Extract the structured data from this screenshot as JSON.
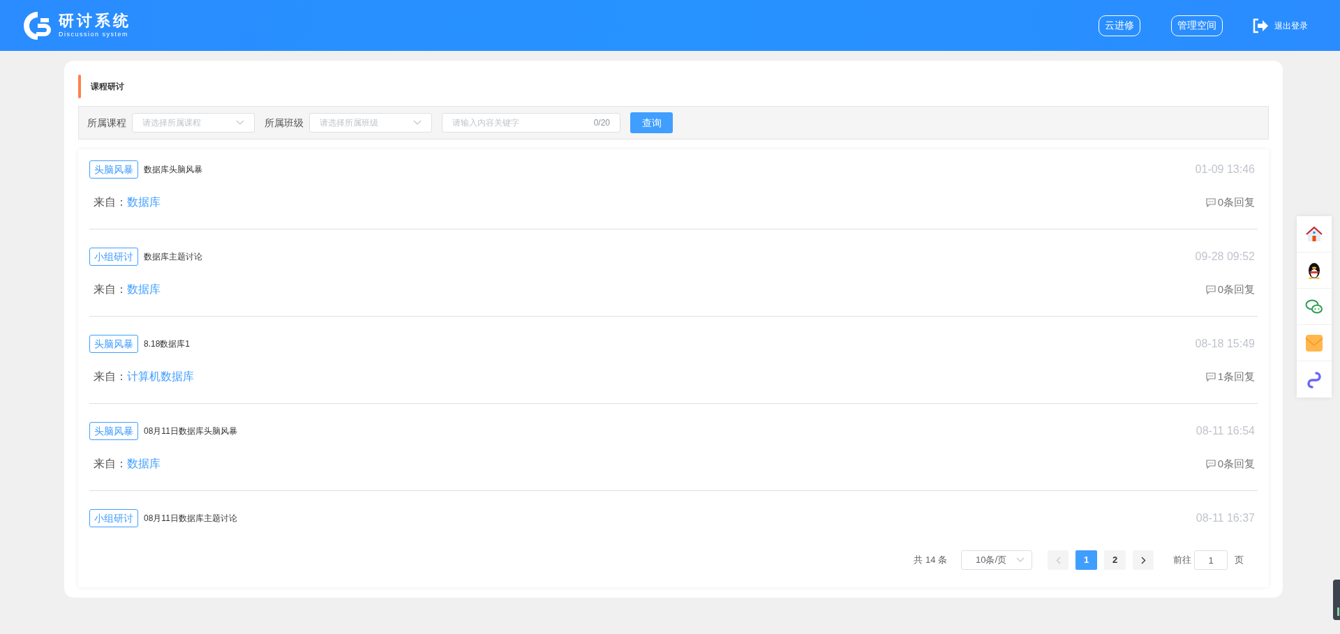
{
  "header": {
    "logo": {
      "title": "研讨系统",
      "subtitle": "Discussion system"
    },
    "nav_buttons": [
      "云进修",
      "管理空间"
    ],
    "logout": "退出登录"
  },
  "page_title": "课程研讨",
  "filters": [
    {
      "kind": "select",
      "label": "所属课程",
      "placeholder": "请选择所属课程"
    },
    {
      "kind": "select",
      "label": "所属班级",
      "placeholder": "请选择所属班级"
    },
    {
      "kind": "text",
      "placeholder": "请输入内容关键字",
      "counter": "0/20"
    }
  ],
  "search_button": "查询",
  "posts": [
    {
      "tag": "头脑风暴",
      "title": "数据库头脑风暴",
      "time": "01-09 13:46",
      "source_label": "来自：",
      "source": "数据库",
      "replies": "0条回复"
    },
    {
      "tag": "小组研讨",
      "title": "数据库主题讨论",
      "time": "09-28 09:52",
      "source_label": "来自：",
      "source": "数据库",
      "replies": "0条回复"
    },
    {
      "tag": "头脑风暴",
      "title": "8.18数据库1",
      "time": "08-18 15:49",
      "source_label": "来自：",
      "source": "计算机数据库",
      "replies": "1条回复"
    },
    {
      "tag": "头脑风暴",
      "title": "08月11日数据库头脑风暴",
      "time": "08-11 16:54",
      "source_label": "来自：",
      "source": "数据库",
      "replies": "0条回复"
    },
    {
      "tag": "小组研讨",
      "title": "08月11日数据库主题讨论",
      "time": "08-11 16:37"
    }
  ],
  "pagination": {
    "total": "共 14 条",
    "page_size": "10条/页",
    "pages": [
      {
        "label": "1",
        "selected": true
      },
      {
        "label": "2",
        "selected": false
      }
    ],
    "goto_label": "前往",
    "goto_value": "1",
    "page_suffix": "页"
  },
  "side_links": [
    {
      "kind": "home"
    },
    {
      "kind": "penguin"
    },
    {
      "kind": "chat"
    },
    {
      "kind": "mail"
    },
    {
      "kind": "link"
    }
  ]
}
